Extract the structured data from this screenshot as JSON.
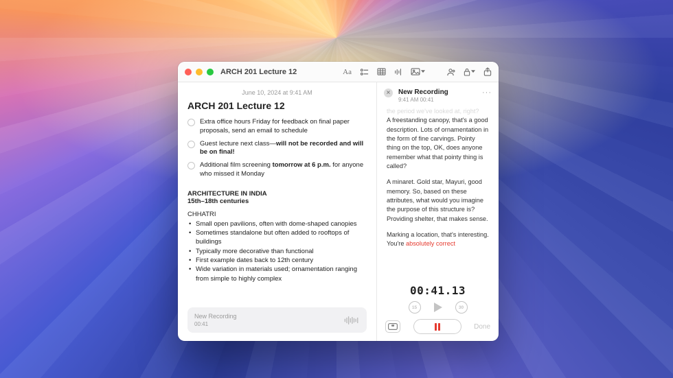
{
  "window": {
    "title": "ARCH 201 Lecture 12",
    "date": "June 10, 2024 at 9:41 AM"
  },
  "note": {
    "title": "ARCH 201 Lecture 12",
    "checks": [
      {
        "pre": "Extra office hours Friday for feedback on final paper proposals, send an email to schedule",
        "bold": "",
        "post": ""
      },
      {
        "pre": "Guest lecture next class—",
        "bold": "will not be recorded and will be on final!",
        "post": ""
      },
      {
        "pre": "Additional film screening ",
        "bold": "tomorrow at 6 p.m.",
        "post": " for anyone who missed it Monday"
      }
    ],
    "section1": "ARCHITECTURE IN INDIA",
    "section1_sub": "15th–18th centuries",
    "listHead": "CHHATRI",
    "bullets": [
      "Small open pavilions, often with dome-shaped canopies",
      "Sometimes standalone but often added to rooftops of buildings",
      "Typically more decorative than functional",
      "First example dates back to 12th century",
      "Wide variation in materials used; ornamentation ranging from simple to highly complex"
    ],
    "recCard": {
      "title": "New Recording",
      "dur": "00:41"
    }
  },
  "panel": {
    "title": "New Recording",
    "sub": "9:41 AM  00:41",
    "more": "···",
    "faded": "the period we've looked at, right?",
    "p1": "A freestanding canopy, that's a good description. Lots of ornamentation in the form of fine carvings. Pointy thing on the top, OK, does anyone remember what that pointy thing is called?",
    "p2": "A minaret. Gold star, Mayuri, good memory. So, based on these attributes, what would you imagine the purpose of this structure is? Providing shelter, that makes sense.",
    "p3_a": "Marking a location, that's interesting. You're ",
    "p3_red": "absolutely correct",
    "timer": "00:41.13",
    "skipBack": "15",
    "skipFwd": "30",
    "done": "Done"
  }
}
